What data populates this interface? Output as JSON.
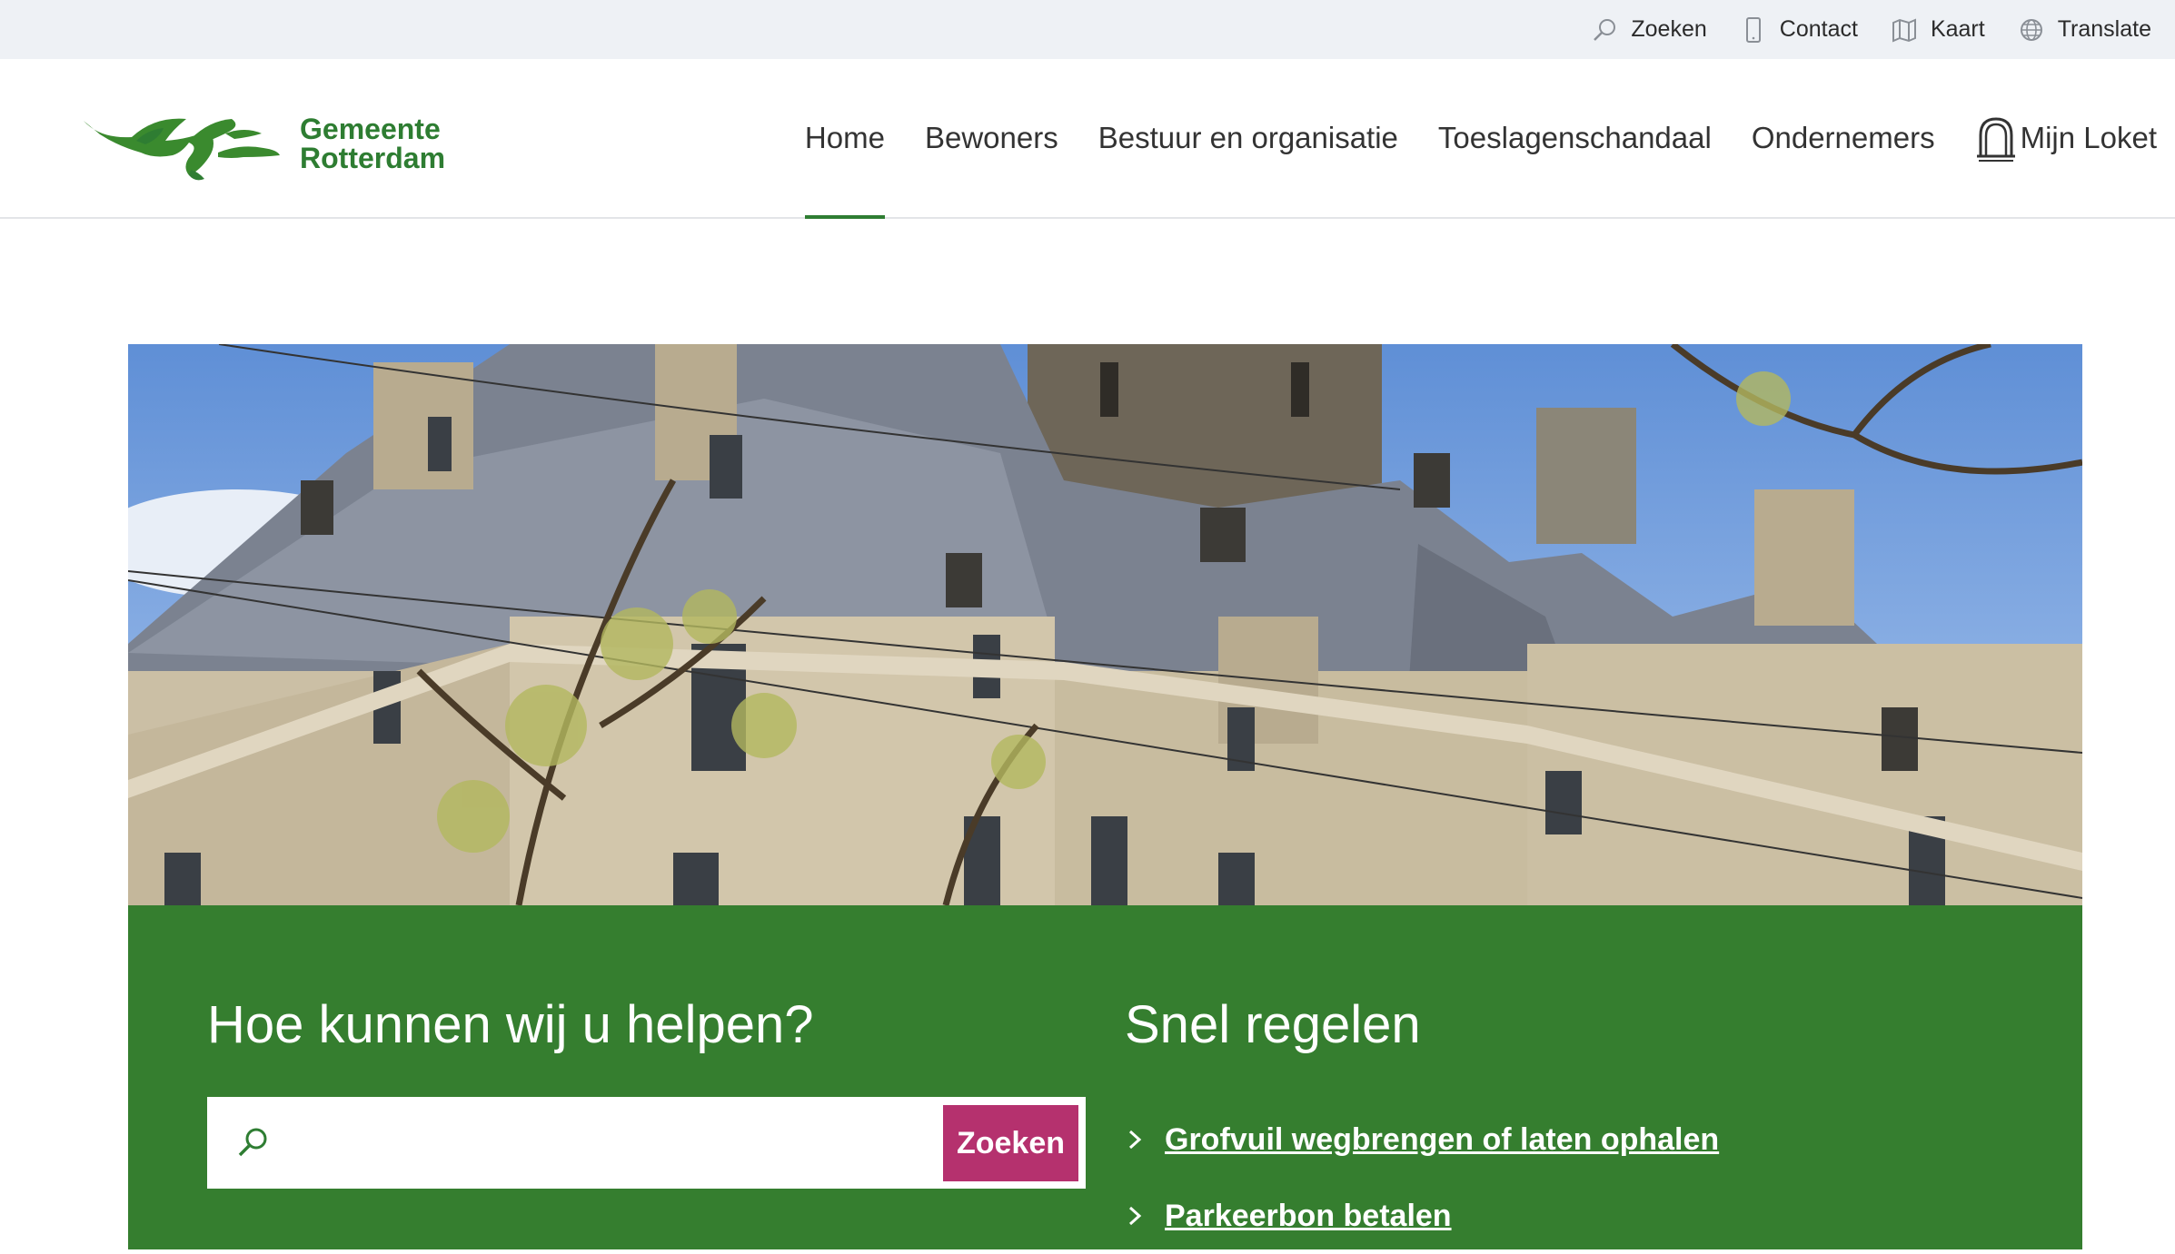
{
  "utility": {
    "search": "Zoeken",
    "contact": "Contact",
    "map": "Kaart",
    "translate": "Translate"
  },
  "logo": {
    "line1": "Gemeente",
    "line2": "Rotterdam"
  },
  "nav": {
    "items": [
      "Home",
      "Bewoners",
      "Bestuur en organisatie",
      "Toeslagenschandaal",
      "Ondernemers"
    ],
    "active": "Home",
    "mijn_loket": "Mijn Loket"
  },
  "help": {
    "title": "Hoe kunnen wij u helpen?",
    "search_value": "",
    "search_button": "Zoeken"
  },
  "snel": {
    "title": "Snel regelen",
    "links": [
      "Grofvuil wegbrengen of laten ophalen",
      "Parkeerbon betalen"
    ]
  },
  "colors": {
    "brand_green": "#357e2f",
    "logo_green": "#2e7d32",
    "button_magenta": "#b5316e",
    "utility_bg": "#eef1f5"
  },
  "icons": [
    "search-icon",
    "phone-icon",
    "map-icon",
    "globe-icon",
    "bell-icon",
    "chevron-right-icon"
  ]
}
